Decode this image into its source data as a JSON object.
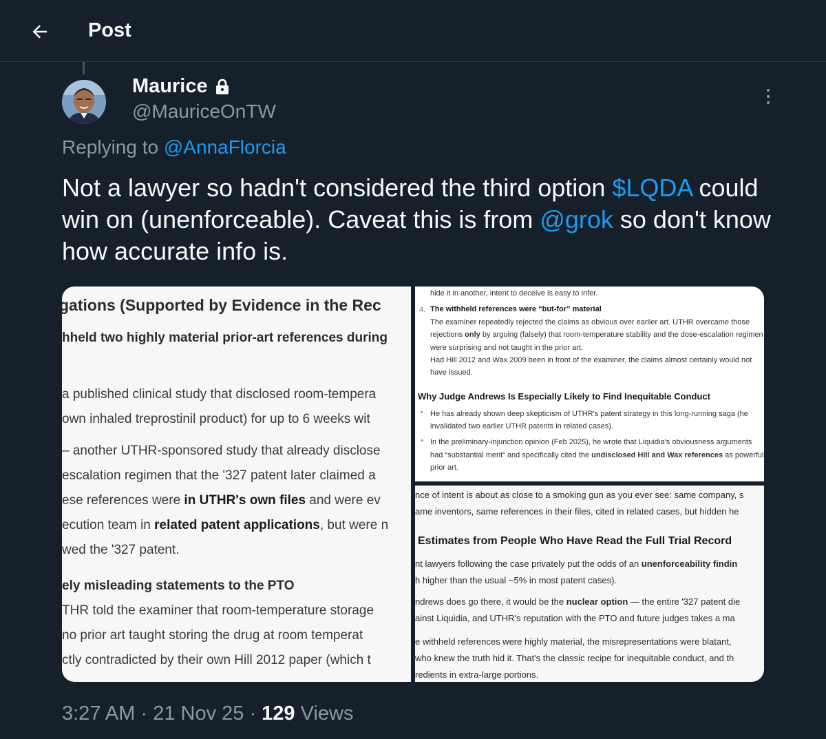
{
  "header": {
    "title": "Post",
    "back_icon": "arrow-left-icon"
  },
  "author": {
    "name": "Maurice",
    "lock_icon": "lock-icon",
    "handle": "@MauriceOnTW"
  },
  "reply": {
    "prefix": "Replying to",
    "mention": "@AnnaFlorcia"
  },
  "tweet": {
    "part1": "Not a lawyer so hadn't considered the third option ",
    "cashtag": "$LQDA",
    "part2": " could win on (unenforceable). Caveat this is from ",
    "mention": "@grok",
    "part3": " so don't know how accurate info is."
  },
  "media": {
    "left": {
      "heading": "gations (Supported by Evidence in the Rec",
      "line1": "hheld two highly material prior-art references during",
      "line2": "a published clinical study that disclosed room-tempera",
      "line3": "own inhaled treprostinil product) for up to 6 weeks wit",
      "line4": "– another UTHR-sponsored study that already disclose",
      "line5": "escalation regimen that the '327 patent later claimed a",
      "line6a": "ese references were ",
      "line6b": "in UTHR's own files",
      "line6c": " and were ev",
      "line7a": "ecution team in ",
      "line7b": "related patent applications",
      "line7c": ", but were n",
      "line8": "wed the '327 patent.",
      "subheading": "ely misleading statements to the PTO",
      "line9": "THR told the examiner that room-temperature storage",
      "line10": "no prior art taught storing the drug at room temperat",
      "line11": "ctly contradicted by their own Hill 2012 paper (which t"
    },
    "top_right": {
      "line1": "hide it in another, intent to deceive is easy to infer.",
      "item_num": "4.",
      "item_title": "The withheld references were “but-for” material",
      "line2": "The examiner repeatedly rejected the claims as obvious over earlier art. UTHR overcame those",
      "line3a": "rejections ",
      "line3b": "only",
      "line3c": " by arguing (falsely) that room-temperature stability and the dose-escalation regimen",
      "line4": "were surprising and not taught in the prior art.",
      "line5": "Had Hill 2012 and Wax 2009 been in front of the examiner, the claims almost certainly would not",
      "line6": "have issued.",
      "heading": "Why Judge Andrews Is Especially Likely to Find Inequitable Conduct",
      "bullet1a": "He has already shown deep skepticism of UTHR's patent strategy in this long-running saga (he",
      "bullet1b": "invalidated two earlier UTHR patents in related cases).",
      "bullet2a": "In the preliminary-injunction opinion (Feb 2025), he wrote that Liquidia's obviousness arguments",
      "bullet2b1": "had “substantial merit” and specifically cited the ",
      "bullet2b2": "undisclosed Hill and Wax references",
      "bullet2b3": " as powerful",
      "bullet2c": "prior art."
    },
    "bottom_right": {
      "line1": "nce of intent is about as close to a smoking gun as you ever see: same company, s",
      "line2": "ame inventors, same references in their files, cited in related cases, but hidden he",
      "heading": "Estimates from People Who Have Read the Full Trial Record",
      "line3a": "nt lawyers following the case privately put the odds of an ",
      "line3b": "unenforceability findin",
      "line4": "h higher than the usual ~5% in most patent cases).",
      "line5a": "ndrews does go there, it would be the ",
      "line5b": "nuclear option",
      "line5c": " — the entire '327 patent die",
      "line6": "ainst Liquidia, and UTHR's reputation with the PTO and future judges takes a ma",
      "line7": "e withheld references were highly material, the misrepresentations were blatant,",
      "line8": "who knew the truth hid it. That's the classic recipe for inequitable conduct, and th",
      "line9": "redients in extra-large portions."
    }
  },
  "meta": {
    "time": "3:27 AM",
    "sep": " · ",
    "date": "21 Nov 25",
    "views_count": "129",
    "views_label": " Views"
  }
}
